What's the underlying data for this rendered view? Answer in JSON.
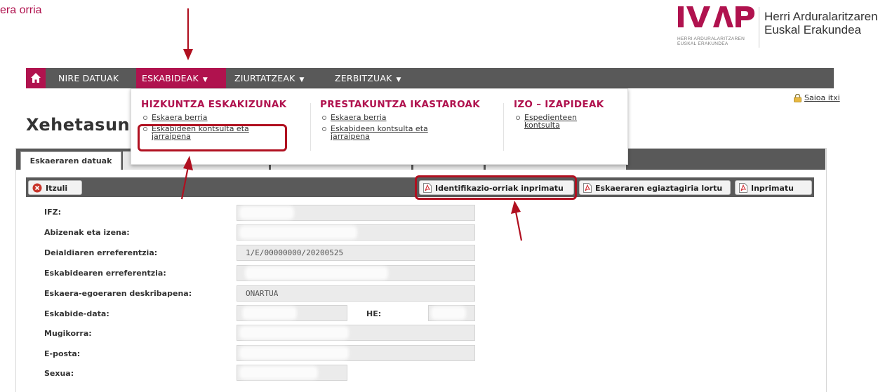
{
  "header": {
    "top_text": "era orria",
    "logo_sub_line1": "HERRI ARDURALARITZAREN",
    "logo_sub_line2": "EUSKAL ERAKUNDEA",
    "org_name_line1": "Herri Arduralaritzaren",
    "org_name_line2": "Euskal Erakundea"
  },
  "nav": {
    "items": [
      {
        "label": "NIRE DATUAK"
      },
      {
        "label": "ESKABIDEAK",
        "caret": "▼"
      },
      {
        "label": "ZIURTATZEAK",
        "caret": "▼"
      },
      {
        "label": "ZERBITZUAK",
        "caret": "▼"
      }
    ]
  },
  "dropdown": {
    "columns": [
      {
        "heading": "HIZKUNTZA ESKAKIZUNAK",
        "links": [
          "Eskaera berria",
          "Eskabideen kontsulta eta jarraipena"
        ]
      },
      {
        "heading": "PRESTAKUNTZA IKASTAROAK",
        "links": [
          "Eskaera berria",
          "Eskabideen kontsulta eta jarraipena"
        ]
      },
      {
        "heading": "IZO – IZAPIDEAK",
        "links": [
          "Espedienteen kontsulta"
        ]
      }
    ]
  },
  "logout": "Saioa itxi",
  "page_title": "Xehetasuna",
  "tabs": {
    "active": "Eskaeraren datuak"
  },
  "toolbar": {
    "back": "Itzuli",
    "print_ids": "Identifikazio-orriak inprimatu",
    "get_proof": "Eskaeraren egiaztagiria lortu",
    "print": "Inprimatu"
  },
  "form": {
    "ifz_label": "IFZ:",
    "name_label": "Abizenak eta izena:",
    "call_ref_label": "Deialdiaren erreferentzia:",
    "call_ref_value": "1/E/00000000/20200525",
    "app_ref_label": "Eskabidearen erreferentzia:",
    "status_label": "Eskaera-egoeraren deskribapena:",
    "status_value": "ONARTUA",
    "date_label": "Eskabide-data:",
    "he_label": "HE:",
    "mobile_label": "Mugikorra:",
    "email_label": "E-posta:",
    "sex_label": "Sexua:"
  },
  "colors": {
    "brand": "#b0124e",
    "nav_bg": "#595959",
    "annotation": "#b01020"
  }
}
